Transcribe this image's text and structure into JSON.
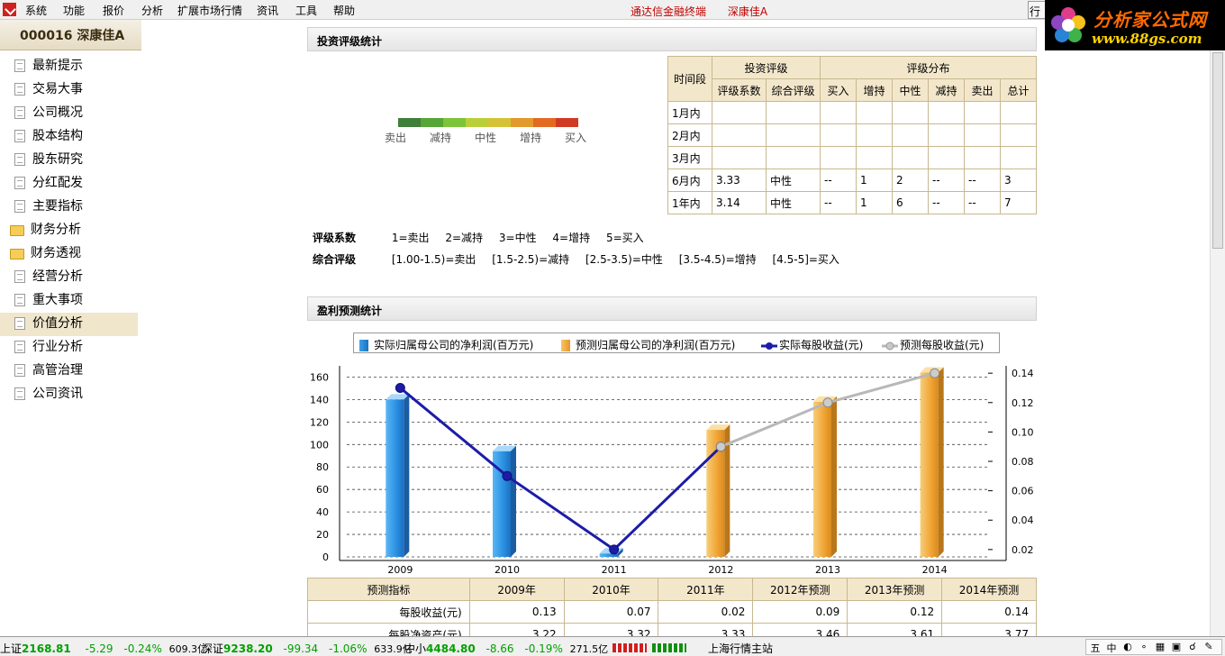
{
  "menubar": {
    "items": [
      "系统",
      "功能",
      "报价",
      "分析",
      "扩展市场行情",
      "资讯",
      "工具",
      "帮助"
    ],
    "center_title": "通达信金融终端",
    "center_stock": "深康佳A",
    "right_char": "行"
  },
  "brand": {
    "line1": "分析家公式网",
    "line2": "www.88gs.com"
  },
  "sidebar": {
    "stock_title": "000016  深康佳A",
    "items": [
      {
        "label": "最新提示",
        "icon": "document-icon"
      },
      {
        "label": "交易大事",
        "icon": "document-icon"
      },
      {
        "label": "公司概况",
        "icon": "document-icon"
      },
      {
        "label": "股本结构",
        "icon": "document-icon"
      },
      {
        "label": "股东研究",
        "icon": "document-icon"
      },
      {
        "label": "分红配发",
        "icon": "document-icon"
      },
      {
        "label": "主要指标",
        "icon": "document-icon"
      },
      {
        "label": "财务分析",
        "icon": "folder-icon"
      },
      {
        "label": "财务透视",
        "icon": "folder-icon"
      },
      {
        "label": "经营分析",
        "icon": "document-icon"
      },
      {
        "label": "重大事项",
        "icon": "document-icon"
      },
      {
        "label": "价值分析",
        "icon": "document-icon"
      },
      {
        "label": "行业分析",
        "icon": "document-icon"
      },
      {
        "label": "高管治理",
        "icon": "document-icon"
      },
      {
        "label": "公司资讯",
        "icon": "document-icon"
      }
    ],
    "active_index": 11
  },
  "rating": {
    "section_title": "投资评级统计",
    "scale_labels": [
      "卖出",
      "减持",
      "中性",
      "增持",
      "买入"
    ],
    "scale_colors": [
      "#3f7f3a",
      "#55a636",
      "#7cc43a",
      "#b9cf3a",
      "#d6c236",
      "#e39a2c",
      "#e26a22",
      "#d03a24"
    ],
    "table": {
      "col_period": "时间段",
      "group_rating": "投资评级",
      "group_dist": "评级分布",
      "sub_headers": [
        "评级系数",
        "综合评级",
        "买入",
        "增持",
        "中性",
        "减持",
        "卖出",
        "总计"
      ],
      "rows": [
        {
          "period": "1月内",
          "cells": [
            "",
            "",
            "",
            "",
            "",
            "",
            "",
            ""
          ]
        },
        {
          "period": "2月内",
          "cells": [
            "",
            "",
            "",
            "",
            "",
            "",
            "",
            ""
          ]
        },
        {
          "period": "3月内",
          "cells": [
            "",
            "",
            "",
            "",
            "",
            "",
            "",
            ""
          ]
        },
        {
          "period": "6月内",
          "cells": [
            "3.33",
            "中性",
            "--",
            "1",
            "2",
            "--",
            "--",
            "3"
          ]
        },
        {
          "period": "1年内",
          "cells": [
            "3.14",
            "中性",
            "--",
            "1",
            "6",
            "--",
            "--",
            "7"
          ]
        }
      ]
    },
    "notes": {
      "coef_label": "评级系数",
      "coef_items": [
        "1=卖出",
        "2=减持",
        "3=中性",
        "4=增持",
        "5=买入"
      ],
      "overall_label": "综合评级",
      "overall_items": [
        "[1.00-1.5)=卖出",
        "[1.5-2.5)=减持",
        "[2.5-3.5)=中性",
        "[3.5-4.5)=增持",
        "[4.5-5]=买入"
      ]
    }
  },
  "profit": {
    "section_title": "盈利预测统计",
    "legend": [
      "实际归属母公司的净利润(百万元)",
      "预测归属母公司的净利润(百万元)",
      "实际每股收益(元)",
      "预测每股收益(元)"
    ],
    "colors": {
      "actual_bar": "#2a8fe0",
      "forecast_bar": "#f2a535",
      "actual_line": "#1c1ca8",
      "forecast_line": "#b8b8b8"
    }
  },
  "chart_data": {
    "type": "bar",
    "categories": [
      "2009",
      "2010",
      "2011",
      "2012",
      "2013",
      "2014"
    ],
    "series": [
      {
        "name": "实际归属母公司的净利润(百万元)",
        "kind": "bar",
        "axis": "left",
        "values": [
          140,
          94,
          3,
          null,
          null,
          null
        ]
      },
      {
        "name": "预测归属母公司的净利润(百万元)",
        "kind": "bar",
        "axis": "left",
        "values": [
          null,
          null,
          null,
          113,
          138,
          164
        ]
      },
      {
        "name": "实际每股收益(元)",
        "kind": "line",
        "axis": "right",
        "values": [
          0.13,
          0.07,
          0.02,
          0.09,
          null,
          null
        ]
      },
      {
        "name": "预测每股收益(元)",
        "kind": "line",
        "axis": "right",
        "values": [
          null,
          null,
          null,
          0.09,
          0.12,
          0.14
        ]
      }
    ],
    "left_ticks": [
      "0",
      "20",
      "40",
      "60",
      "80",
      "100",
      "120",
      "140",
      "160"
    ],
    "right_ticks": [
      "0.02",
      "0.04",
      "0.06",
      "0.08",
      "0.10",
      "0.12",
      "0.14"
    ],
    "ylim_left": [
      0,
      170
    ],
    "ylim_right": [
      0.015,
      0.145
    ],
    "grid": true,
    "legend_position": "top"
  },
  "forecast_table": {
    "headers": [
      "预测指标",
      "2009年",
      "2010年",
      "2011年",
      "2012年预测",
      "2013年预测",
      "2014年预测"
    ],
    "rows": [
      {
        "label": "每股收益(元)",
        "cells": [
          "0.13",
          "0.07",
          "0.02",
          "0.09",
          "0.12",
          "0.14"
        ]
      },
      {
        "label": "每股净资产(元)",
        "cells": [
          "3.22",
          "3.32",
          "3.33",
          "3.46",
          "3.61",
          "3.77"
        ]
      }
    ]
  },
  "statusbar": {
    "sh": {
      "label": "上证",
      "price": "2168.81",
      "chg": "-5.29",
      "pct": "-0.24%",
      "amt": "609.3亿"
    },
    "sz": {
      "label": "深证",
      "price": "9238.20",
      "chg": "-99.34",
      "pct": "-1.06%",
      "amt": "633.9亿"
    },
    "zx": {
      "label": "中小",
      "price": "4484.80",
      "chg": "-8.66",
      "pct": "-0.19%",
      "amt": "271.5亿"
    },
    "station": "上海行情主站",
    "tray": [
      "五",
      "中",
      "◐",
      "∘",
      "▦",
      "▣",
      "☌",
      "✎"
    ]
  }
}
